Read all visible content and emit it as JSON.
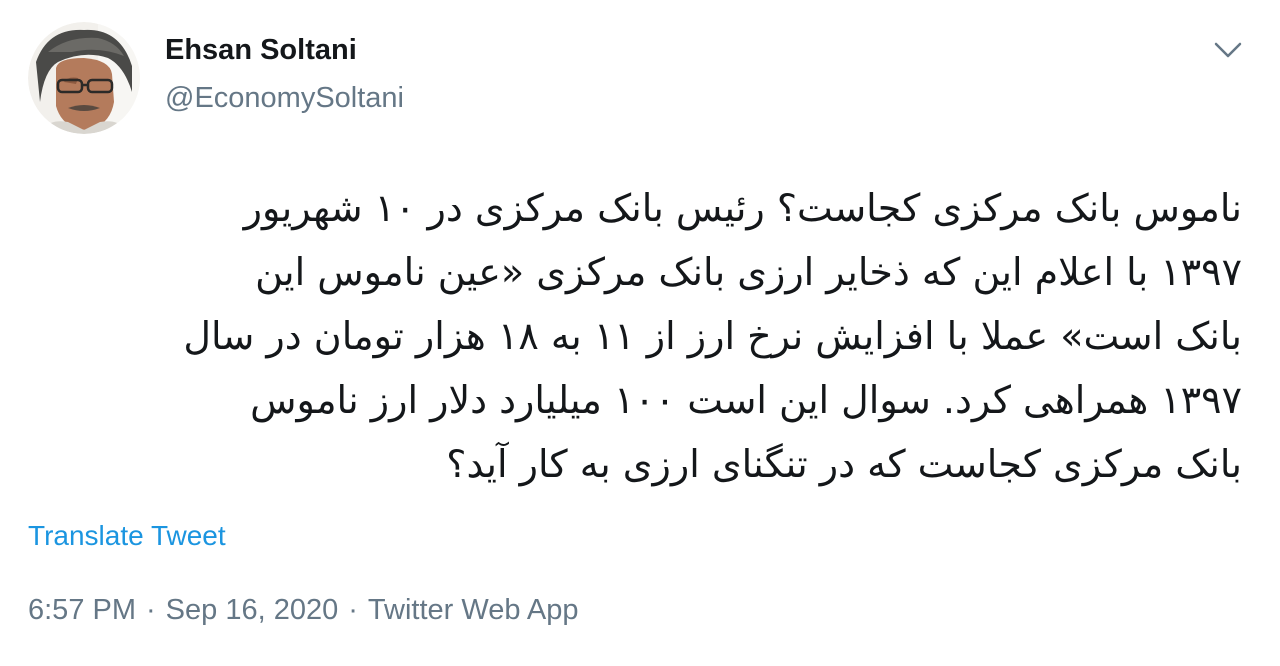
{
  "author": {
    "name": "Ehsan Soltani",
    "handle": "@EconomySoltani"
  },
  "icons": {
    "menu": "chevron-down-icon",
    "avatar": "profile-photo"
  },
  "tweet": {
    "lines": [
      "ناموس بانک مرکزی کجاست؟ رئیس بانک مرکزی در ۱۰ شهریور",
      "۱۳۹۷ با اعلام این که ذخایر ارزی بانک مرکزی «عین ناموس این",
      "بانک است» عملا با افزایش نرخ ارز از ۱۱ به ۱۸ هزار تومان در سال",
      "۱۳۹۷ همراهی کرد. سوال این است ۱۰۰ میلیارد دلار ارز ناموس",
      "بانک مرکزی کجاست که در تنگنای ارزی به کار آید؟"
    ]
  },
  "translate_label": "Translate Tweet",
  "meta": {
    "time": "6:57 PM",
    "separator": "·",
    "date": "Sep 16, 2020",
    "source": "Twitter Web App"
  },
  "colors": {
    "text": "#14171a",
    "secondary": "#657786",
    "link": "#1b95e0"
  }
}
